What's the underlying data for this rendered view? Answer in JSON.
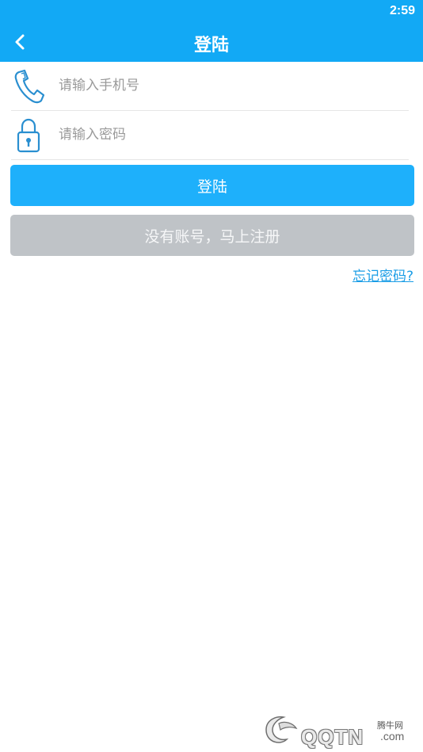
{
  "status_bar": {
    "time": "2:59"
  },
  "app_bar": {
    "title": "登陆",
    "back_icon": "chevron-left-icon"
  },
  "form": {
    "phone": {
      "placeholder": "请输入手机号",
      "value": "",
      "icon": "phone-icon"
    },
    "password": {
      "placeholder": "请输入密码",
      "value": "",
      "icon": "lock-icon"
    },
    "login_label": "登陆",
    "register_label": "没有账号，马上注册",
    "forgot_label": "忘记密码?"
  },
  "colors": {
    "primary": "#12a9f5",
    "button_primary": "#1eb0fb",
    "button_secondary": "#bfc3c7",
    "link": "#1a9de6"
  },
  "watermark": {
    "cn": "腾牛网",
    "en": "QQTN",
    "suffix": ".com"
  }
}
